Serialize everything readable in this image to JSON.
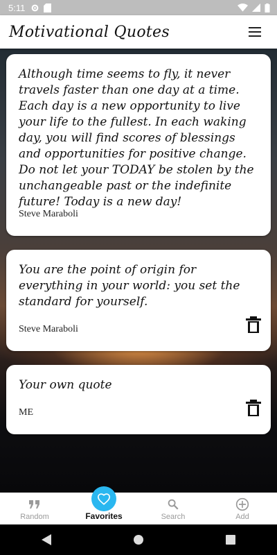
{
  "status_bar": {
    "time": "5:11"
  },
  "app": {
    "title": "Motivational Quotes"
  },
  "quotes": [
    {
      "text": "Although time seems to fly, it never travels faster than one day at a time. Each day is a new opportunity to live your life to the fullest. In each waking day, you will find scores of blessings and opportunities for positive change. Do not let your TODAY be stolen by the unchangeable past or the indefinite future! Today is a new day!",
      "author": "Steve Maraboli"
    },
    {
      "text": "You are the point of origin for everything in your world: you set the standard for yourself.",
      "author": "Steve Maraboli"
    },
    {
      "text": "Your own quote",
      "author": "ME"
    }
  ],
  "bottom_nav": {
    "items": [
      {
        "label": "Random",
        "icon": "quote-icon"
      },
      {
        "label": "Favorites",
        "icon": "heart-icon"
      },
      {
        "label": "Search",
        "icon": "search-icon"
      },
      {
        "label": "Add",
        "icon": "add-circle-icon"
      }
    ],
    "active": "Favorites"
  },
  "colors": {
    "accent": "#2ab7f0",
    "inactive_label": "#9a9a9a"
  }
}
